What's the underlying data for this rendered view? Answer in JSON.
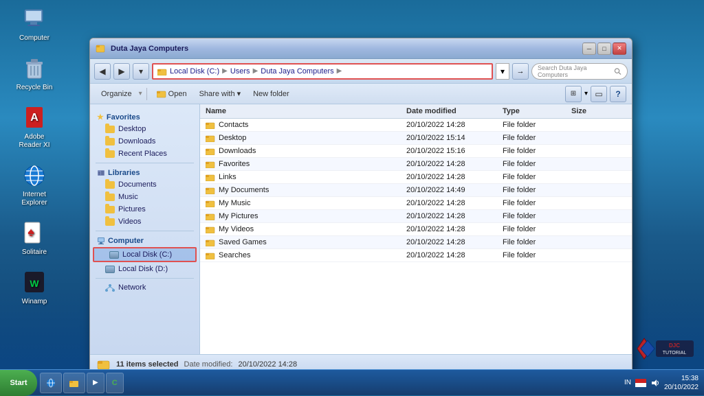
{
  "desktop": {
    "icons": [
      {
        "id": "computer",
        "label": "Computer"
      },
      {
        "id": "recycle-bin",
        "label": "Recycle Bin"
      },
      {
        "id": "adobe-reader",
        "label": "Adobe Reader XI"
      },
      {
        "id": "internet-explorer",
        "label": "Internet Explorer"
      },
      {
        "id": "solitaire",
        "label": "Solitaire"
      },
      {
        "id": "winamp",
        "label": "Winamp"
      }
    ]
  },
  "window": {
    "title": "Duta Jaya Computers",
    "address_path": "Local Disk (C:) ▶ Users ▶ Duta Jaya Computers ▶",
    "path_parts": [
      "Local Disk (C:)",
      "Users",
      "Duta Jaya Computers"
    ],
    "search_placeholder": "Search Duta Jaya Computers"
  },
  "toolbar": {
    "organize": "Organize",
    "open": "Open",
    "share_with": "Share with",
    "new_folder": "New folder"
  },
  "sidebar": {
    "favorites_label": "Favorites",
    "favorites_items": [
      {
        "label": "Desktop"
      },
      {
        "label": "Downloads"
      },
      {
        "label": "Recent Places"
      }
    ],
    "libraries_label": "Libraries",
    "libraries_items": [
      {
        "label": "Documents"
      },
      {
        "label": "Music"
      },
      {
        "label": "Pictures"
      },
      {
        "label": "Videos"
      }
    ],
    "computer_label": "Computer",
    "computer_items": [
      {
        "label": "Local Disk (C:)",
        "selected": true
      },
      {
        "label": "Local Disk (D:)",
        "selected": false
      }
    ],
    "network_label": "Network"
  },
  "file_list": {
    "headers": [
      "Name",
      "Date modified",
      "Type",
      "Size"
    ],
    "files": [
      {
        "name": "Contacts",
        "date": "20/10/2022 14:28",
        "type": "File folder",
        "size": ""
      },
      {
        "name": "Desktop",
        "date": "20/10/2022 15:14",
        "type": "File folder",
        "size": ""
      },
      {
        "name": "Downloads",
        "date": "20/10/2022 15:16",
        "type": "File folder",
        "size": ""
      },
      {
        "name": "Favorites",
        "date": "20/10/2022 14:28",
        "type": "File folder",
        "size": ""
      },
      {
        "name": "Links",
        "date": "20/10/2022 14:28",
        "type": "File folder",
        "size": ""
      },
      {
        "name": "My Documents",
        "date": "20/10/2022 14:49",
        "type": "File folder",
        "size": ""
      },
      {
        "name": "My Music",
        "date": "20/10/2022 14:28",
        "type": "File folder",
        "size": ""
      },
      {
        "name": "My Pictures",
        "date": "20/10/2022 14:28",
        "type": "File folder",
        "size": ""
      },
      {
        "name": "My Videos",
        "date": "20/10/2022 14:28",
        "type": "File folder",
        "size": ""
      },
      {
        "name": "Saved Games",
        "date": "20/10/2022 14:28",
        "type": "File folder",
        "size": ""
      },
      {
        "name": "Searches",
        "date": "20/10/2022 14:28",
        "type": "File folder",
        "size": ""
      }
    ]
  },
  "status": {
    "text": "11 items selected",
    "date_label": "Date modified:",
    "date_value": "20/10/2022 14:28"
  },
  "taskbar": {
    "start_label": "Start",
    "time": "15:38",
    "date": "20/10/2022",
    "tray_items": [
      "IN"
    ]
  },
  "djc": {
    "label": "DJC TUTORIAL"
  }
}
